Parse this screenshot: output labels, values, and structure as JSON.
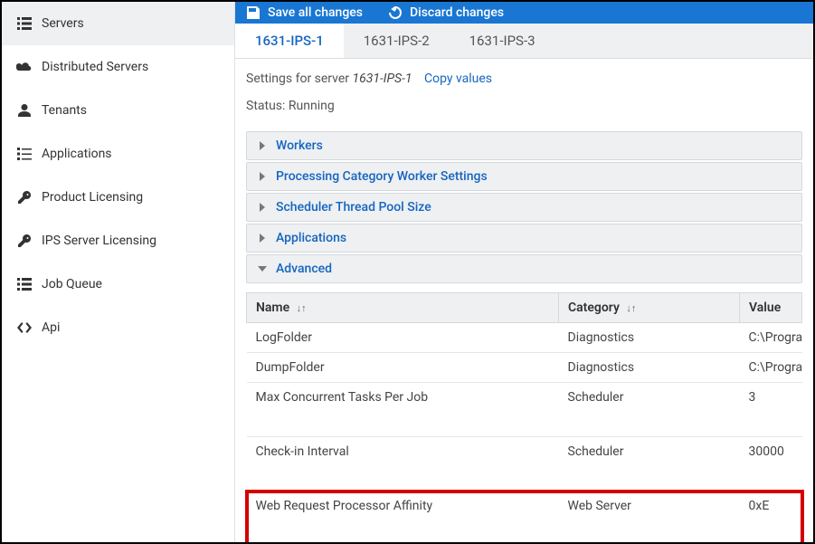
{
  "sidebar": {
    "items": [
      {
        "label": "Servers",
        "icon": "list-icon"
      },
      {
        "label": "Distributed Servers",
        "icon": "cloud-icon"
      },
      {
        "label": "Tenants",
        "icon": "person-icon"
      },
      {
        "label": "Applications",
        "icon": "list-alt-icon"
      },
      {
        "label": "Product Licensing",
        "icon": "key-icon"
      },
      {
        "label": "IPS Server Licensing",
        "icon": "key-icon"
      },
      {
        "label": "Job Queue",
        "icon": "list-icon"
      },
      {
        "label": "Api",
        "icon": "code-icon"
      }
    ]
  },
  "toolbar": {
    "save_label": "Save all changes",
    "discard_label": "Discard changes"
  },
  "tabs": [
    {
      "label": "1631-IPS-1"
    },
    {
      "label": "1631-IPS-2"
    },
    {
      "label": "1631-IPS-3"
    }
  ],
  "settings": {
    "prefix": "Settings for server ",
    "server_name": "1631-IPS-1",
    "copy_label": "Copy values",
    "status_label": "Status: ",
    "status_value": "Running"
  },
  "accordion": [
    {
      "label": "Workers",
      "expanded": false
    },
    {
      "label": "Processing Category Worker Settings",
      "expanded": false
    },
    {
      "label": "Scheduler Thread Pool Size",
      "expanded": false
    },
    {
      "label": "Applications",
      "expanded": false
    },
    {
      "label": "Advanced",
      "expanded": true
    }
  ],
  "table": {
    "headers": {
      "name": "Name",
      "category": "Category",
      "value": "Value",
      "sort_glyph": "↓↑"
    },
    "rows": [
      {
        "name": "LogFolder",
        "category": "Diagnostics",
        "value": "C:\\ProgramDa"
      },
      {
        "name": "DumpFolder",
        "category": "Diagnostics",
        "value": "C:\\ProgramDa"
      },
      {
        "name": "Max Concurrent Tasks Per Job",
        "category": "Scheduler",
        "value": "3"
      },
      {
        "name": "Check-in Interval",
        "category": "Scheduler",
        "value": "30000"
      },
      {
        "name": "Web Request Processor Affinity",
        "category": "Web Server",
        "value": "0xE"
      }
    ]
  }
}
